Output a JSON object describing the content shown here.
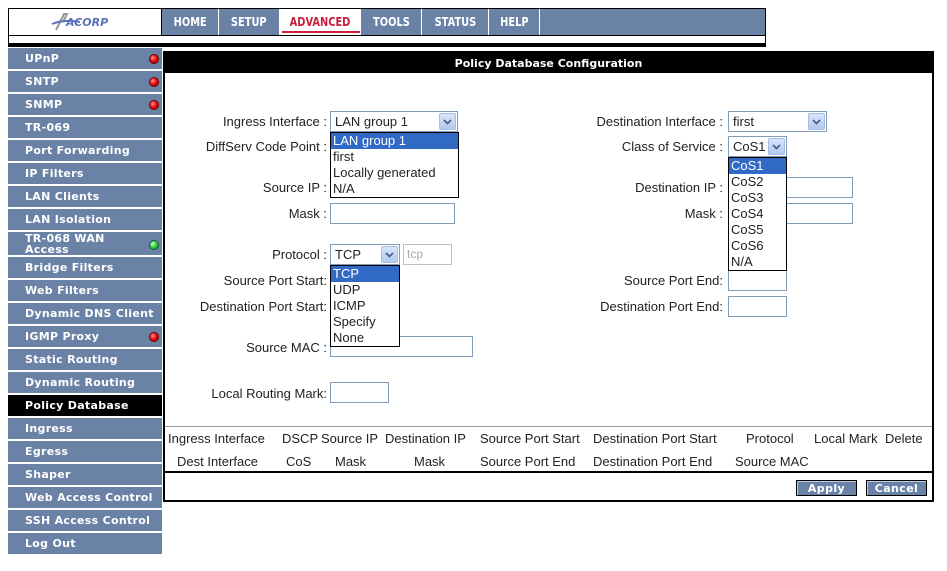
{
  "brand": {
    "logo_text": "ACORP"
  },
  "nav": {
    "tabs": [
      {
        "label": "HOME"
      },
      {
        "label": "SETUP"
      },
      {
        "label": "ADVANCED"
      },
      {
        "label": "TOOLS"
      },
      {
        "label": "STATUS"
      },
      {
        "label": "HELP"
      }
    ],
    "active": "ADVANCED"
  },
  "sidebar": {
    "items": [
      {
        "label": "UPnP",
        "status": "red"
      },
      {
        "label": "SNTP",
        "status": "red"
      },
      {
        "label": "SNMP",
        "status": "red"
      },
      {
        "label": "TR-069"
      },
      {
        "label": "Port Forwarding"
      },
      {
        "label": "IP Filters"
      },
      {
        "label": "LAN Clients"
      },
      {
        "label": "LAN Isolation"
      },
      {
        "label": "TR-068 WAN Access",
        "label_line1": "TR-068 WAN",
        "label_line2": "Access",
        "status": "green"
      },
      {
        "label": "Bridge Filters"
      },
      {
        "label": "Web Filters"
      },
      {
        "label": "Dynamic DNS Client"
      },
      {
        "label": "IGMP Proxy",
        "status": "red"
      },
      {
        "label": "Static Routing"
      },
      {
        "label": "Dynamic Routing"
      },
      {
        "label": "Policy Database",
        "active": true
      },
      {
        "label": "Ingress"
      },
      {
        "label": "Egress"
      },
      {
        "label": "Shaper"
      },
      {
        "label": "Web Access Control"
      },
      {
        "label": "SSH Access Control"
      },
      {
        "label": "Log Out"
      }
    ]
  },
  "panel": {
    "title": "Policy Database Configuration",
    "form": {
      "ingress_interface": {
        "label": "Ingress Interface :",
        "value": "LAN group 1",
        "options": [
          "LAN group 1",
          "first",
          "Locally generated",
          "N/A"
        ]
      },
      "diffserv": {
        "label": "DiffServ Code Point :"
      },
      "source_ip": {
        "label": "Source IP :",
        "value": ""
      },
      "mask_left": {
        "label": "Mask :",
        "value": ""
      },
      "protocol": {
        "label": "Protocol :",
        "value": "TCP",
        "text_value": "tcp",
        "options": [
          "TCP",
          "UDP",
          "ICMP",
          "Specify",
          "None"
        ]
      },
      "source_port_start": {
        "label": "Source Port Start:",
        "value": ""
      },
      "dest_port_start": {
        "label": "Destination Port Start:",
        "value": ""
      },
      "source_mac": {
        "label": "Source MAC :",
        "value": ""
      },
      "local_routing_mark": {
        "label": "Local Routing Mark:",
        "value": ""
      },
      "destination_interface": {
        "label": "Destination Interface :",
        "value": "first"
      },
      "class_of_service": {
        "label": "Class of Service :",
        "value": "CoS1",
        "options": [
          "CoS1",
          "CoS2",
          "CoS3",
          "CoS4",
          "CoS5",
          "CoS6",
          "N/A"
        ]
      },
      "destination_ip": {
        "label": "Destination IP :",
        "value": ""
      },
      "mask_right": {
        "label": "Mask :",
        "value": ""
      },
      "source_port_end": {
        "label": "Source Port End:",
        "value": ""
      },
      "dest_port_end": {
        "label": "Destination Port End:",
        "value": ""
      }
    },
    "table": {
      "header_row1": [
        "Ingress Interface",
        "DSCP",
        "Source IP",
        "Destination IP",
        "Source Port Start",
        "Destination Port Start",
        "Protocol",
        "Local Mark",
        "Delete"
      ],
      "header_row2": [
        "Dest Interface",
        "CoS",
        "Mask",
        "Mask",
        "Source Port End",
        "Destination Port End",
        "Source MAC"
      ]
    },
    "buttons": {
      "apply": "Apply",
      "cancel": "Cancel"
    }
  },
  "colors": {
    "nav_bg": "#6b82a7",
    "active_tab_text": "#c8203a",
    "selection": "#316ac5"
  }
}
